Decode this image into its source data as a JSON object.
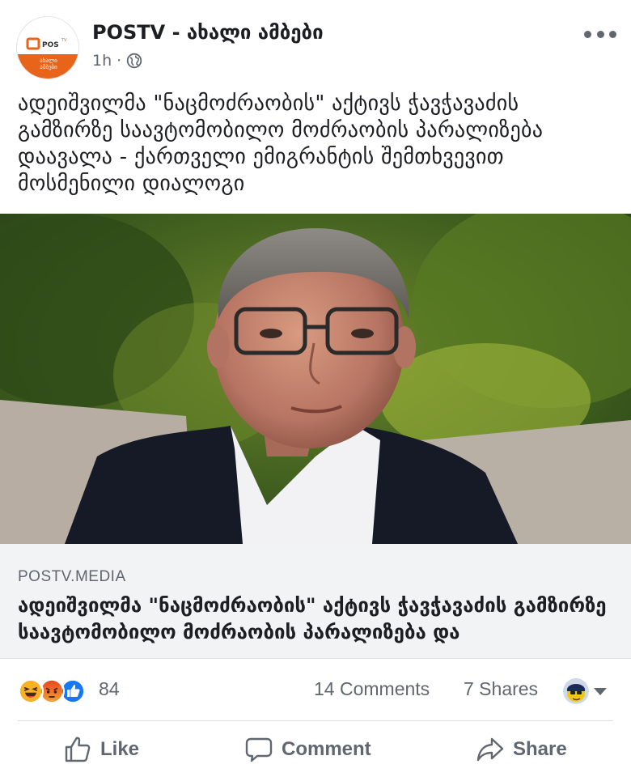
{
  "post": {
    "page_name": "POSTV - ახალი ამბები",
    "time": "1h",
    "separator": "·",
    "avatar_logo_text": "POS",
    "avatar_logo_sup": "TV",
    "avatar_sub_line1": "ახალი",
    "avatar_sub_line2": "ამბები",
    "text": "ადეიშვილმა \"ნაცმოძრაობის\" აქტივს ჭავჭავაძის გამზირზე საავტომობილო მოძრაობის პარალიზება დაავალა - ქართველი ემიგრანტის შემთხვევით მოსმენილი დიალოგი"
  },
  "link_preview": {
    "domain": "POSTV.MEDIA",
    "title": "ადეიშვილმა \"ნაცმოძრაობის\" აქტივს ჭავჭავაძის გამზირზე საავტომობილო მოძრაობის პარალიზება და"
  },
  "engagement": {
    "reaction_count": "84",
    "comments": "14 Comments",
    "shares": "7 Shares",
    "reaction_icons": [
      "haha-icon",
      "angry-icon",
      "like-icon"
    ]
  },
  "actions": {
    "like": "Like",
    "comment": "Comment",
    "share": "Share"
  },
  "colors": {
    "brand_orange": "#e8641b",
    "text_primary": "#1c1e21",
    "text_secondary": "#606770",
    "link_bg": "#f2f3f5",
    "like_blue": "#1877f2",
    "angry_orange": "#e9710f",
    "haha_yellow": "#f7b125"
  }
}
